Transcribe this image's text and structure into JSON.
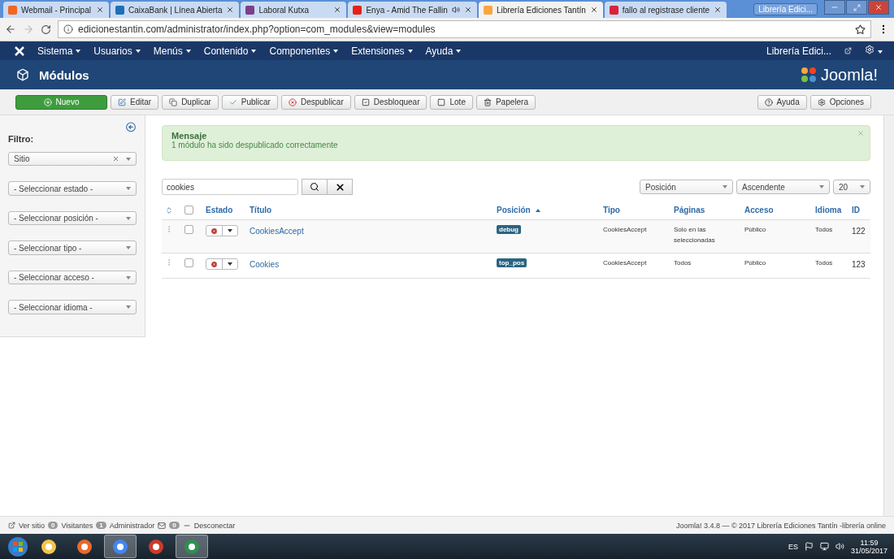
{
  "browser": {
    "tabs": [
      {
        "label": "Webmail - Principal",
        "selected": false,
        "color": "#f26522",
        "audio": false
      },
      {
        "label": "CaixaBank | Línea Abierta",
        "selected": false,
        "color": "#1d6fb8",
        "audio": false
      },
      {
        "label": "Laboral Kutxa",
        "selected": false,
        "color": "#7b3f8c",
        "audio": false
      },
      {
        "label": "Enya - Amid The Fallin",
        "selected": false,
        "color": "#e62117",
        "audio": true
      },
      {
        "label": "Librería Ediciones Tantín",
        "selected": true,
        "color": "#f9a541",
        "audio": false
      },
      {
        "label": "fallo al registrase cliente",
        "selected": false,
        "color": "#d6243a",
        "audio": false
      }
    ],
    "profile": "Librería Edici...",
    "url": "edicionestantin.com/administrator/index.php?option=com_modules&view=modules"
  },
  "nav": {
    "items": [
      "Sistema",
      "Usuarios",
      "Menús",
      "Contenido",
      "Componentes",
      "Extensiones",
      "Ayuda"
    ],
    "site": "Librería Edici..."
  },
  "header": {
    "title": "Módulos",
    "logo": "Joomla!"
  },
  "toolbar": {
    "buttons": [
      {
        "label": "Nuevo",
        "kind": "primary"
      },
      {
        "label": "Editar",
        "kind": "default"
      },
      {
        "label": "Duplicar",
        "kind": "default"
      },
      {
        "label": "Publicar",
        "kind": "default"
      },
      {
        "label": "Despublicar",
        "kind": "default"
      },
      {
        "label": "Desbloquear",
        "kind": "default"
      },
      {
        "label": "Lote",
        "kind": "default"
      },
      {
        "label": "Papelera",
        "kind": "default"
      }
    ],
    "right": [
      "Ayuda",
      "Opciones"
    ]
  },
  "sidebar": {
    "heading": "Filtro:",
    "filters": [
      {
        "value": "Sitio",
        "clearable": true
      },
      {
        "value": "- Seleccionar estado -",
        "clearable": false
      },
      {
        "value": "- Seleccionar posición -",
        "clearable": false
      },
      {
        "value": "- Seleccionar tipo -",
        "clearable": false
      },
      {
        "value": "- Seleccionar acceso -",
        "clearable": false
      },
      {
        "value": "- Seleccionar idioma -",
        "clearable": false
      }
    ]
  },
  "message": {
    "heading": "Mensaje",
    "text": "1 módulo ha sido despublicado correctamente"
  },
  "search": {
    "value": "cookies"
  },
  "sorting": [
    "Posición",
    "Ascendente",
    "20"
  ],
  "table": {
    "all_checked": false,
    "columns": [
      {
        "label": "Estado",
        "sorted": false
      },
      {
        "label": "Título",
        "sorted": false
      },
      {
        "label": "Posición",
        "sorted": true
      },
      {
        "label": "Tipo",
        "sorted": false
      },
      {
        "label": "Páginas",
        "sorted": false
      },
      {
        "label": "Acceso",
        "sorted": false
      },
      {
        "label": "Idioma",
        "sorted": false
      },
      {
        "label": "ID",
        "sorted": false
      }
    ],
    "rows": [
      {
        "checked": false,
        "published": false,
        "title": "CookiesAccept",
        "position": "debug",
        "type": "CookiesAccept",
        "pages": "Solo en las seleccionadas",
        "access": "Público",
        "language": "Todos",
        "id": "122"
      },
      {
        "checked": false,
        "published": false,
        "title": "Cookies",
        "position": "top_pos",
        "type": "CookiesAccept",
        "pages": "Todos",
        "access": "Público",
        "language": "Todos",
        "id": "123"
      }
    ]
  },
  "footer": {
    "view_site": "Ver sitio",
    "visitors_count": "0",
    "visitors": "Visitantes",
    "admins_count": "1",
    "admins": "Administrador",
    "messages_count": "0",
    "logout": "Desconectar",
    "copyright": "Joomla! 3.4.8 — © 2017 Librería Ediciones Tantín -librería online"
  },
  "taskbar": {
    "apps": [
      {
        "active": false
      },
      {
        "active": false
      },
      {
        "active": true
      },
      {
        "active": false
      },
      {
        "active": true
      }
    ],
    "language": "ES",
    "time": "11:59",
    "date": "31/05/2017"
  }
}
